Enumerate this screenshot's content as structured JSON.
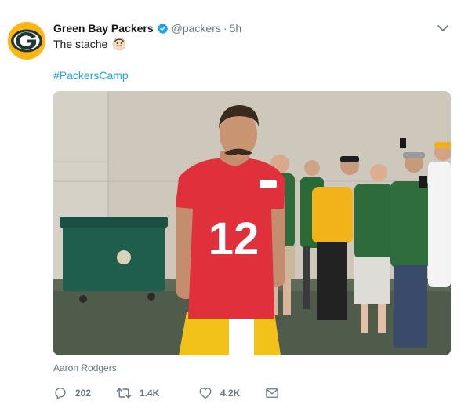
{
  "account": {
    "display_name": "Green Bay Packers",
    "handle": "@packers",
    "separator": "·",
    "time": "5h",
    "verified": true,
    "avatar_icon": "packers-g-logo-icon",
    "avatar_colors": {
      "background": "#ffb612",
      "inner": "#203731"
    }
  },
  "tweet": {
    "text": "The stache",
    "emoji": "mustache-face-emoji",
    "hashtag": "#PackersCamp"
  },
  "media": {
    "caption": "Aaron Rodgers",
    "jersey_number": "12"
  },
  "actions": {
    "replies": "202",
    "retweets": "1.4K",
    "likes": "4.2K",
    "reply_icon": "reply-icon",
    "retweet_icon": "retweet-icon",
    "like_icon": "heart-icon",
    "dm_icon": "envelope-icon"
  },
  "colors": {
    "link": "#1da1f2",
    "muted": "#657786",
    "verified": "#1da1f2",
    "jersey": "#e0303b"
  }
}
